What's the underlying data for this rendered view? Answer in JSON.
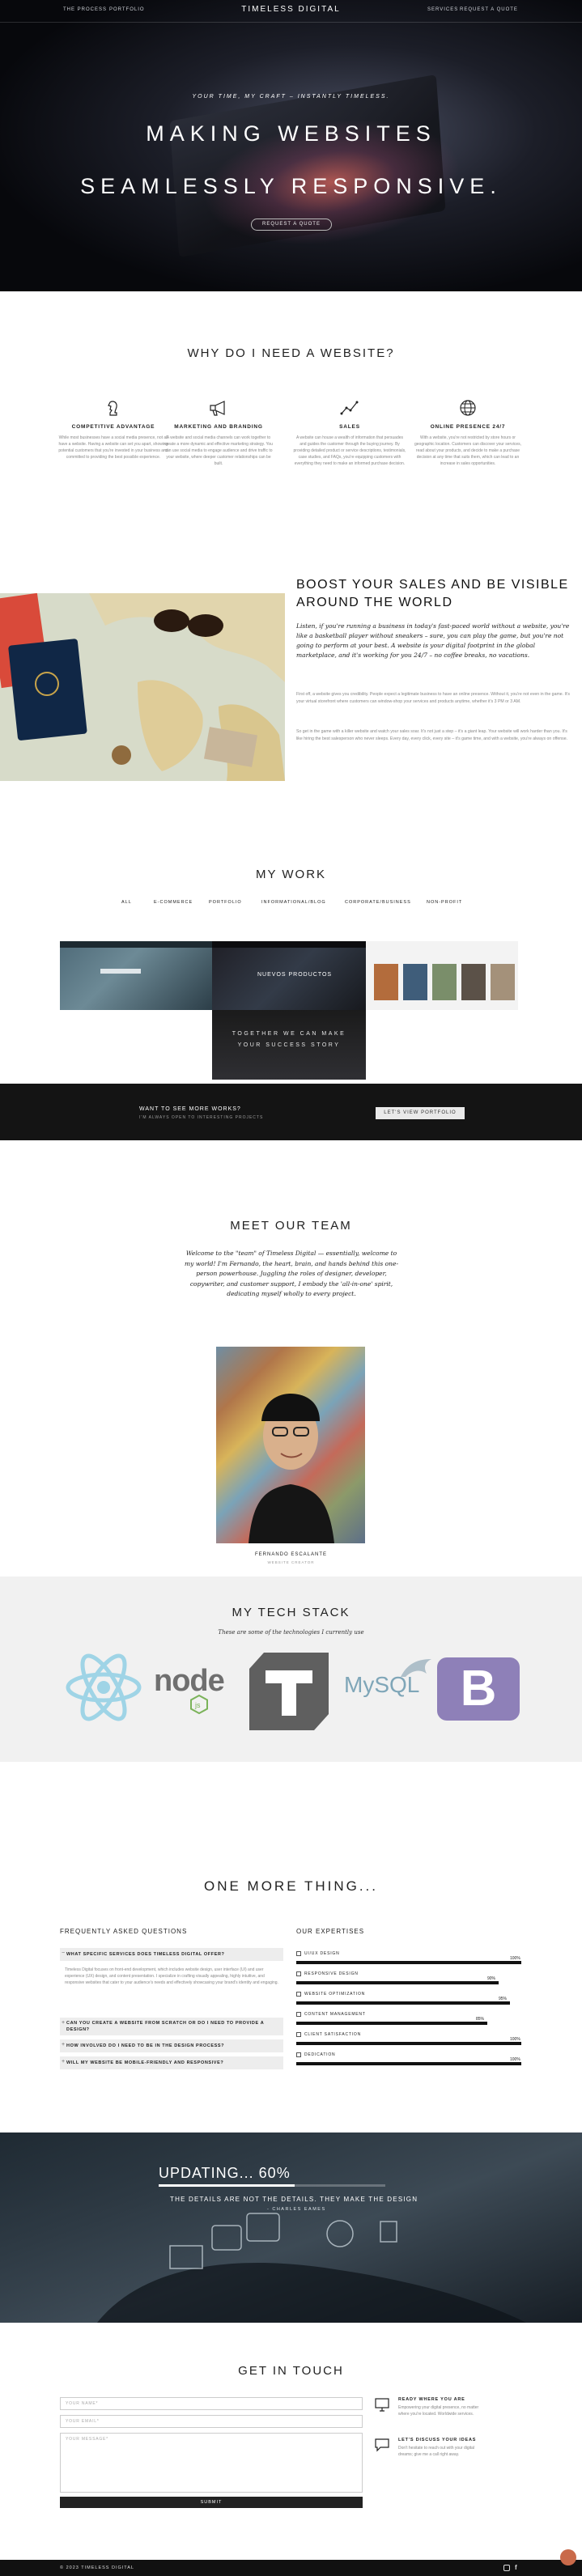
{
  "nav": {
    "left": [
      "THE PROCESS",
      "PORTFOLIO"
    ],
    "brand": "TIMELESS DIGITAL",
    "right": [
      "SERVICES",
      "REQUEST A QUOTE"
    ]
  },
  "hero": {
    "tagline": "YOUR TIME, MY CRAFT – INSTANTLY TIMELESS.",
    "line1": "MAKING WEBSITES",
    "line2": "SEAMLESSLY RESPONSIVE.",
    "button": "REQUEST A QUOTE"
  },
  "why": {
    "title": "WHY DO I NEED A WEBSITE?",
    "features": [
      {
        "icon": "chess-knight-icon",
        "title": "COMPETITIVE ADVANTAGE",
        "text": "While most businesses have a social media presence, not all have a website. Having a website can set you apart, showing potential customers that you're invested in your business and committed to providing the best possible experience."
      },
      {
        "icon": "megaphone-icon",
        "title": "MARKETING AND BRANDING",
        "text": "A website and social media channels can work together to create a more dynamic and effective marketing strategy. You can use social media to engage audience and drive traffic to your website, where deeper customer relationships can be built."
      },
      {
        "icon": "chart-line-icon",
        "title": "SALES",
        "text": "A website can house a wealth of information that persuades and guides the customer through the buying journey. By providing detailed product or service descriptions, testimonials, case studies, and FAQs, you're equipping customers with everything they need to make an informed purchase decision."
      },
      {
        "icon": "globe-icon",
        "title": "ONLINE PRESENCE 24/7",
        "text": "With a website, you're not restricted by store hours or geographic location. Customers can discover your services, read about your products, and decide to make a purchase decision at any time that suits them, which can lead to an increase in sales opportunities."
      }
    ]
  },
  "boost": {
    "title": "BOOST YOUR SALES AND BE VISIBLE AROUND THE WORLD",
    "lead": "Listen, if you're running a business in today's fast-paced world without a website, you're like a basketball player without sneakers – sure, you can play the game, but you're not going to perform at your best. A website is your digital footprint in the global marketplace, and it's working for you 24/7 – no coffee breaks, no vacations.",
    "p1": "First off, a website gives you credibility. People expect a legitimate business to have an online presence. Without it, you're not even in the game. It's your virtual storefront where customers can window-shop your services and products anytime, whether it's 3 PM or 3 AM.",
    "p2": "So get in the game with a killer website and watch your sales soar. It's not just a step – it's a giant leap. Your website will work harder than you. It's like hiring the best salesperson who never sleeps. Every day, every click, every site – it's game time, and with a website, you're always on offense."
  },
  "work": {
    "title": "MY WORK",
    "filters": [
      "ALL",
      "E-COMMERCE",
      "PORTFOLIO",
      "INFORMATIONAL/BLOG",
      "CORPORATE/BUSINESS",
      "NON-PROFIT"
    ],
    "tile_nuevos": "NUEVOS PRODUCTOS",
    "tile_together_1": "TOGETHER WE CAN MAKE",
    "tile_together_2": "YOUR SUCCESS STORY"
  },
  "more": {
    "title": "WANT TO SEE MORE WORKS?",
    "subtitle": "I'M ALWAYS OPEN TO INTERESTING PROJECTS",
    "button": "LET'S VIEW PORTFOLIO"
  },
  "team": {
    "title": "MEET OUR TEAM",
    "intro": "Welcome to the \"team\" of Timeless Digital — essentially, welcome to my world! I'm Fernando, the heart, brain, and hands behind this one-person powerhouse. Juggling the roles of designer, developer, copywriter, and customer support, I embody the 'all-in-one' spirit, dedicating myself wholly to every project.",
    "name": "FERNANDO ESCALANTE",
    "role": "WEBSITE CREATOR"
  },
  "tech": {
    "title": "MY TECH STACK",
    "subtitle": "These are some of the technologies I currently use",
    "logos": [
      "react-logo-icon",
      "nodejs-logo-icon",
      "typo3-logo-icon",
      "mysql-logo-icon",
      "bootstrap-logo-icon"
    ],
    "node_text": "node",
    "mysql_text": "MySQL",
    "bootstrap_text": "B",
    "colors": {
      "react": "#9fd4e6",
      "node": "#6f6f6f",
      "node_green": "#7bb35a",
      "typo3": "#5f5f5f",
      "mysql": "#7fa6b8",
      "bootstrap": "#8e80b8"
    }
  },
  "more_thing": {
    "title": "ONE MORE THING...",
    "faq_title": "FREQUENTLY ASKED QUESTIONS",
    "faq": [
      {
        "q": "WHAT SPECIFIC SERVICES DOES TIMELESS DIGITAL OFFER?",
        "open": true,
        "a": "Timeless Digital focuses on front-end development, which includes website design, user interface (UI) and user experience (UX) design, and content presentation. I specialize in crafting visually appealing, highly intuitive, and responsive websites that cater to your audience's needs and effectively showcasing your brand's identity and engaging."
      },
      {
        "q": "CAN YOU CREATE A WEBSITE FROM SCRATCH OR DO I NEED TO PROVIDE A DESIGN?",
        "open": false
      },
      {
        "q": "HOW INVOLVED DO I NEED TO BE IN THE DESIGN PROCESS?",
        "open": false
      },
      {
        "q": "WILL MY WEBSITE BE MOBILE-FRIENDLY AND RESPONSIVE?",
        "open": false
      }
    ],
    "expertise_title": "OUR EXPERTISES",
    "skills": [
      {
        "label": "UI/UX DESIGN",
        "value": 100,
        "text": "100%"
      },
      {
        "label": "RESPONSIVE DESIGN",
        "value": 90,
        "text": "90%"
      },
      {
        "label": "WEBSITE OPTIMIZATION",
        "value": 95,
        "text": "95%"
      },
      {
        "label": "CONTENT MANAGEMENT",
        "value": 85,
        "text": "85%"
      },
      {
        "label": "CLIENT SATISFACTION",
        "value": 100,
        "text": "100%"
      },
      {
        "label": "DEDICATION",
        "value": 100,
        "text": "100%"
      }
    ]
  },
  "updating": {
    "title": "UPDATING... 60%",
    "progress": 60,
    "subtitle": "THE DETAILS ARE NOT THE DETAILS. THEY MAKE THE DESIGN",
    "author": "- CHARLES EAMES"
  },
  "contact": {
    "title": "GET IN TOUCH",
    "name_ph": "YOUR NAME*",
    "email_ph": "YOUR EMAIL*",
    "message_ph": "YOUR MESSAGE*",
    "submit": "SUBMIT",
    "info": [
      {
        "icon": "monitor-icon",
        "title": "READY WHERE YOU ARE",
        "text": "Empowering your digital presence, no matter where you're located. Worldwide services."
      },
      {
        "icon": "chat-icon",
        "title": "LET'S DISCUSS YOUR IDEAS",
        "text": "Don't hesitate to reach out with your digital dreams; give me a call right away."
      }
    ]
  },
  "footer": {
    "copyright": "© 2023 TIMELESS DIGITAL",
    "social": [
      "instagram-icon",
      "facebook-icon"
    ]
  }
}
